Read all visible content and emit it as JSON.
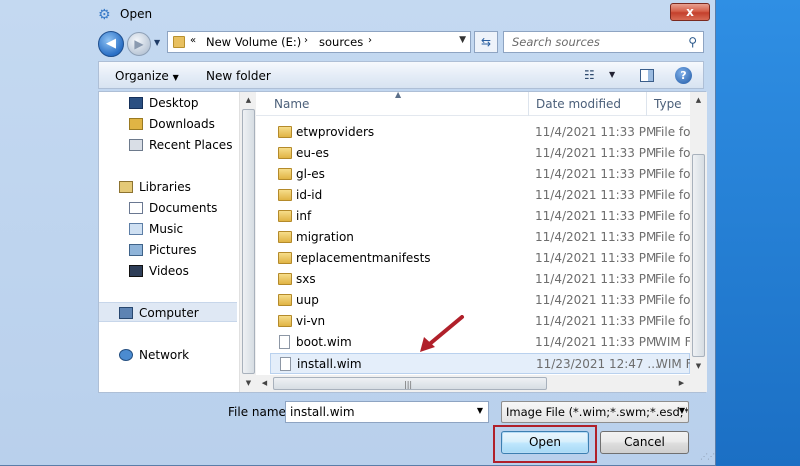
{
  "window": {
    "title": "Open",
    "close_label": "x"
  },
  "address": {
    "prefix": "«",
    "crumbs": [
      "New Volume (E:)",
      "sources"
    ],
    "separator": "›"
  },
  "search": {
    "placeholder": "Search sources"
  },
  "toolbar": {
    "organize_label": "Organize",
    "new_folder_label": "New folder",
    "help_label": "?"
  },
  "nav": {
    "items": [
      {
        "label": "Desktop",
        "icon": "desktop-icon"
      },
      {
        "label": "Downloads",
        "icon": "downloads-icon"
      },
      {
        "label": "Recent Places",
        "icon": "recent-places-icon"
      },
      {
        "label": "Libraries",
        "icon": "libraries-icon"
      },
      {
        "label": "Documents",
        "icon": "documents-icon"
      },
      {
        "label": "Music",
        "icon": "music-icon"
      },
      {
        "label": "Pictures",
        "icon": "pictures-icon"
      },
      {
        "label": "Videos",
        "icon": "videos-icon"
      },
      {
        "label": "Computer",
        "icon": "computer-icon",
        "selected": true
      },
      {
        "label": "Network",
        "icon": "network-icon"
      }
    ]
  },
  "files": {
    "columns": [
      "Name",
      "Date modified",
      "Type"
    ],
    "rows": [
      {
        "name": "etwproviders",
        "date": "11/4/2021 11:33 PM",
        "type": "File fol",
        "kind": "folder"
      },
      {
        "name": "eu-es",
        "date": "11/4/2021 11:33 PM",
        "type": "File fol",
        "kind": "folder"
      },
      {
        "name": "gl-es",
        "date": "11/4/2021 11:33 PM",
        "type": "File fol",
        "kind": "folder"
      },
      {
        "name": "id-id",
        "date": "11/4/2021 11:33 PM",
        "type": "File fol",
        "kind": "folder"
      },
      {
        "name": "inf",
        "date": "11/4/2021 11:33 PM",
        "type": "File fol",
        "kind": "folder"
      },
      {
        "name": "migration",
        "date": "11/4/2021 11:33 PM",
        "type": "File fol",
        "kind": "folder"
      },
      {
        "name": "replacementmanifests",
        "date": "11/4/2021 11:33 PM",
        "type": "File fol",
        "kind": "folder"
      },
      {
        "name": "sxs",
        "date": "11/4/2021 11:33 PM",
        "type": "File fol",
        "kind": "folder"
      },
      {
        "name": "uup",
        "date": "11/4/2021 11:33 PM",
        "type": "File fol",
        "kind": "folder"
      },
      {
        "name": "vi-vn",
        "date": "11/4/2021 11:33 PM",
        "type": "File fol",
        "kind": "folder"
      },
      {
        "name": "boot.wim",
        "date": "11/4/2021 11:33 PM",
        "type": "WIM F",
        "kind": "file"
      },
      {
        "name": "install.wim",
        "date": "11/23/2021 12:47 ...",
        "type": "WIM F",
        "kind": "file",
        "selected": true
      }
    ]
  },
  "footer": {
    "filename_label": "File name:",
    "filename_value": "install.wim",
    "filetype_value": "Image File (*.wim;*.swm;*.esd;*",
    "open_label": "Open",
    "cancel_label": "Cancel"
  },
  "colors": {
    "annotation": "#b0202a",
    "selection": "#e4eefa",
    "window_frame": "#c4d9f1"
  }
}
